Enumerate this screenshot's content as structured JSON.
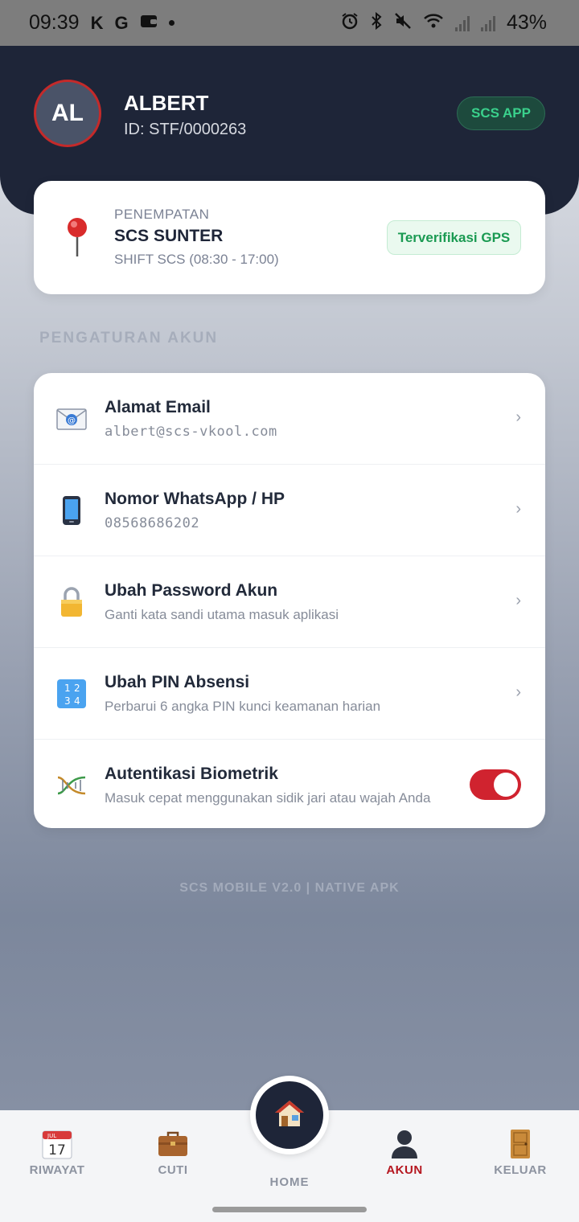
{
  "status_bar": {
    "time": "09:39",
    "battery": "43%",
    "icons": [
      "k-app-icon",
      "google-icon",
      "wallet-icon",
      "dot-icon",
      "alarm-icon",
      "bluetooth-icon",
      "mute-icon",
      "wifi-icon",
      "signal-icon",
      "signal-icon"
    ]
  },
  "profile": {
    "initials": "AL",
    "name": "ALBERT",
    "id": "ID: STF/0000263",
    "badge": "SCS APP"
  },
  "placement": {
    "label": "PENEMPATAN",
    "site": "SCS SUNTER",
    "shift": "SHIFT SCS (08:30 - 17:00)",
    "status": "Terverifikasi GPS"
  },
  "account_settings": {
    "title": "PENGATURAN AKUN",
    "items": [
      {
        "title": "Alamat Email",
        "subtitle": "albert@scs-vkool.com",
        "icon": "email-icon"
      },
      {
        "title": "Nomor WhatsApp / HP",
        "subtitle": "08568686202",
        "icon": "phone-icon"
      },
      {
        "title": "Ubah Password Akun",
        "subtitle": "Ganti kata sandi utama masuk aplikasi",
        "icon": "lock-icon"
      },
      {
        "title": "Ubah PIN Absensi",
        "subtitle": "Perbarui 6 angka PIN kunci keamanan harian",
        "icon": "numbers-icon"
      },
      {
        "title": "Autentikasi Biometrik",
        "subtitle": "Masuk cepat menggunakan sidik jari atau wajah Anda",
        "icon": "dna-icon",
        "enabled": true
      }
    ],
    "chevron": "›"
  },
  "footer": {
    "version": "SCS MOBILE V2.0 | NATIVE APK"
  },
  "bottom_nav": {
    "items": [
      {
        "label": "RIWAYAT",
        "icon": "calendar-icon",
        "calendar_month": "JUL",
        "calendar_day": "17"
      },
      {
        "label": "CUTI",
        "icon": "briefcase-icon"
      },
      {
        "label": "HOME",
        "icon": "house-icon"
      },
      {
        "label": "AKUN",
        "icon": "person-icon",
        "active": true
      },
      {
        "label": "KELUAR",
        "icon": "door-icon"
      }
    ]
  },
  "colors": {
    "header": "#1e2538",
    "accent_red": "#c42a2a",
    "gps_green": "#1a9a52",
    "badge_green": "#3ad18c"
  }
}
